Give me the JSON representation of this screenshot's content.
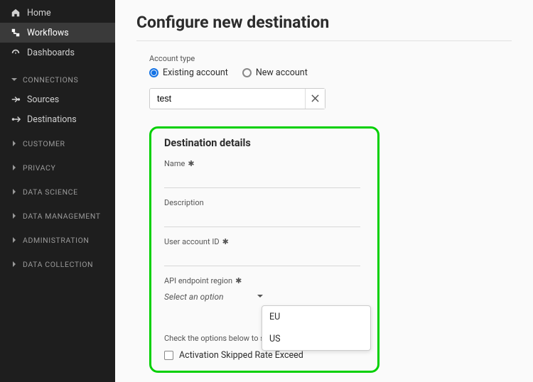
{
  "sidebar": {
    "items_top": [
      {
        "label": "Home",
        "icon": "home-icon"
      },
      {
        "label": "Workflows",
        "icon": "workflow-icon",
        "active": true
      },
      {
        "label": "Dashboards",
        "icon": "gauge-icon"
      }
    ],
    "group_connections": {
      "label": "CONNECTIONS",
      "items": [
        {
          "label": "Sources",
          "icon": "sources-icon"
        },
        {
          "label": "Destinations",
          "icon": "destinations-icon"
        }
      ]
    },
    "groups_collapsed": [
      "CUSTOMER",
      "PRIVACY",
      "DATA SCIENCE",
      "DATA MANAGEMENT",
      "ADMINISTRATION",
      "DATA COLLECTION"
    ]
  },
  "page": {
    "title": "Configure new destination",
    "account_type_label": "Account type",
    "radio_existing": "Existing account",
    "radio_new": "New account",
    "search_value": "test"
  },
  "details": {
    "heading": "Destination details",
    "name_label": "Name",
    "description_label": "Description",
    "user_account_label": "User account ID",
    "api_region_label": "API endpoint region",
    "select_placeholder": "Select an option",
    "options": [
      "EU",
      "US"
    ],
    "alerts_note": "Check the options below to subscribe to different alerts.",
    "alert_checkbox_label": "Activation Skipped Rate Exceed"
  }
}
